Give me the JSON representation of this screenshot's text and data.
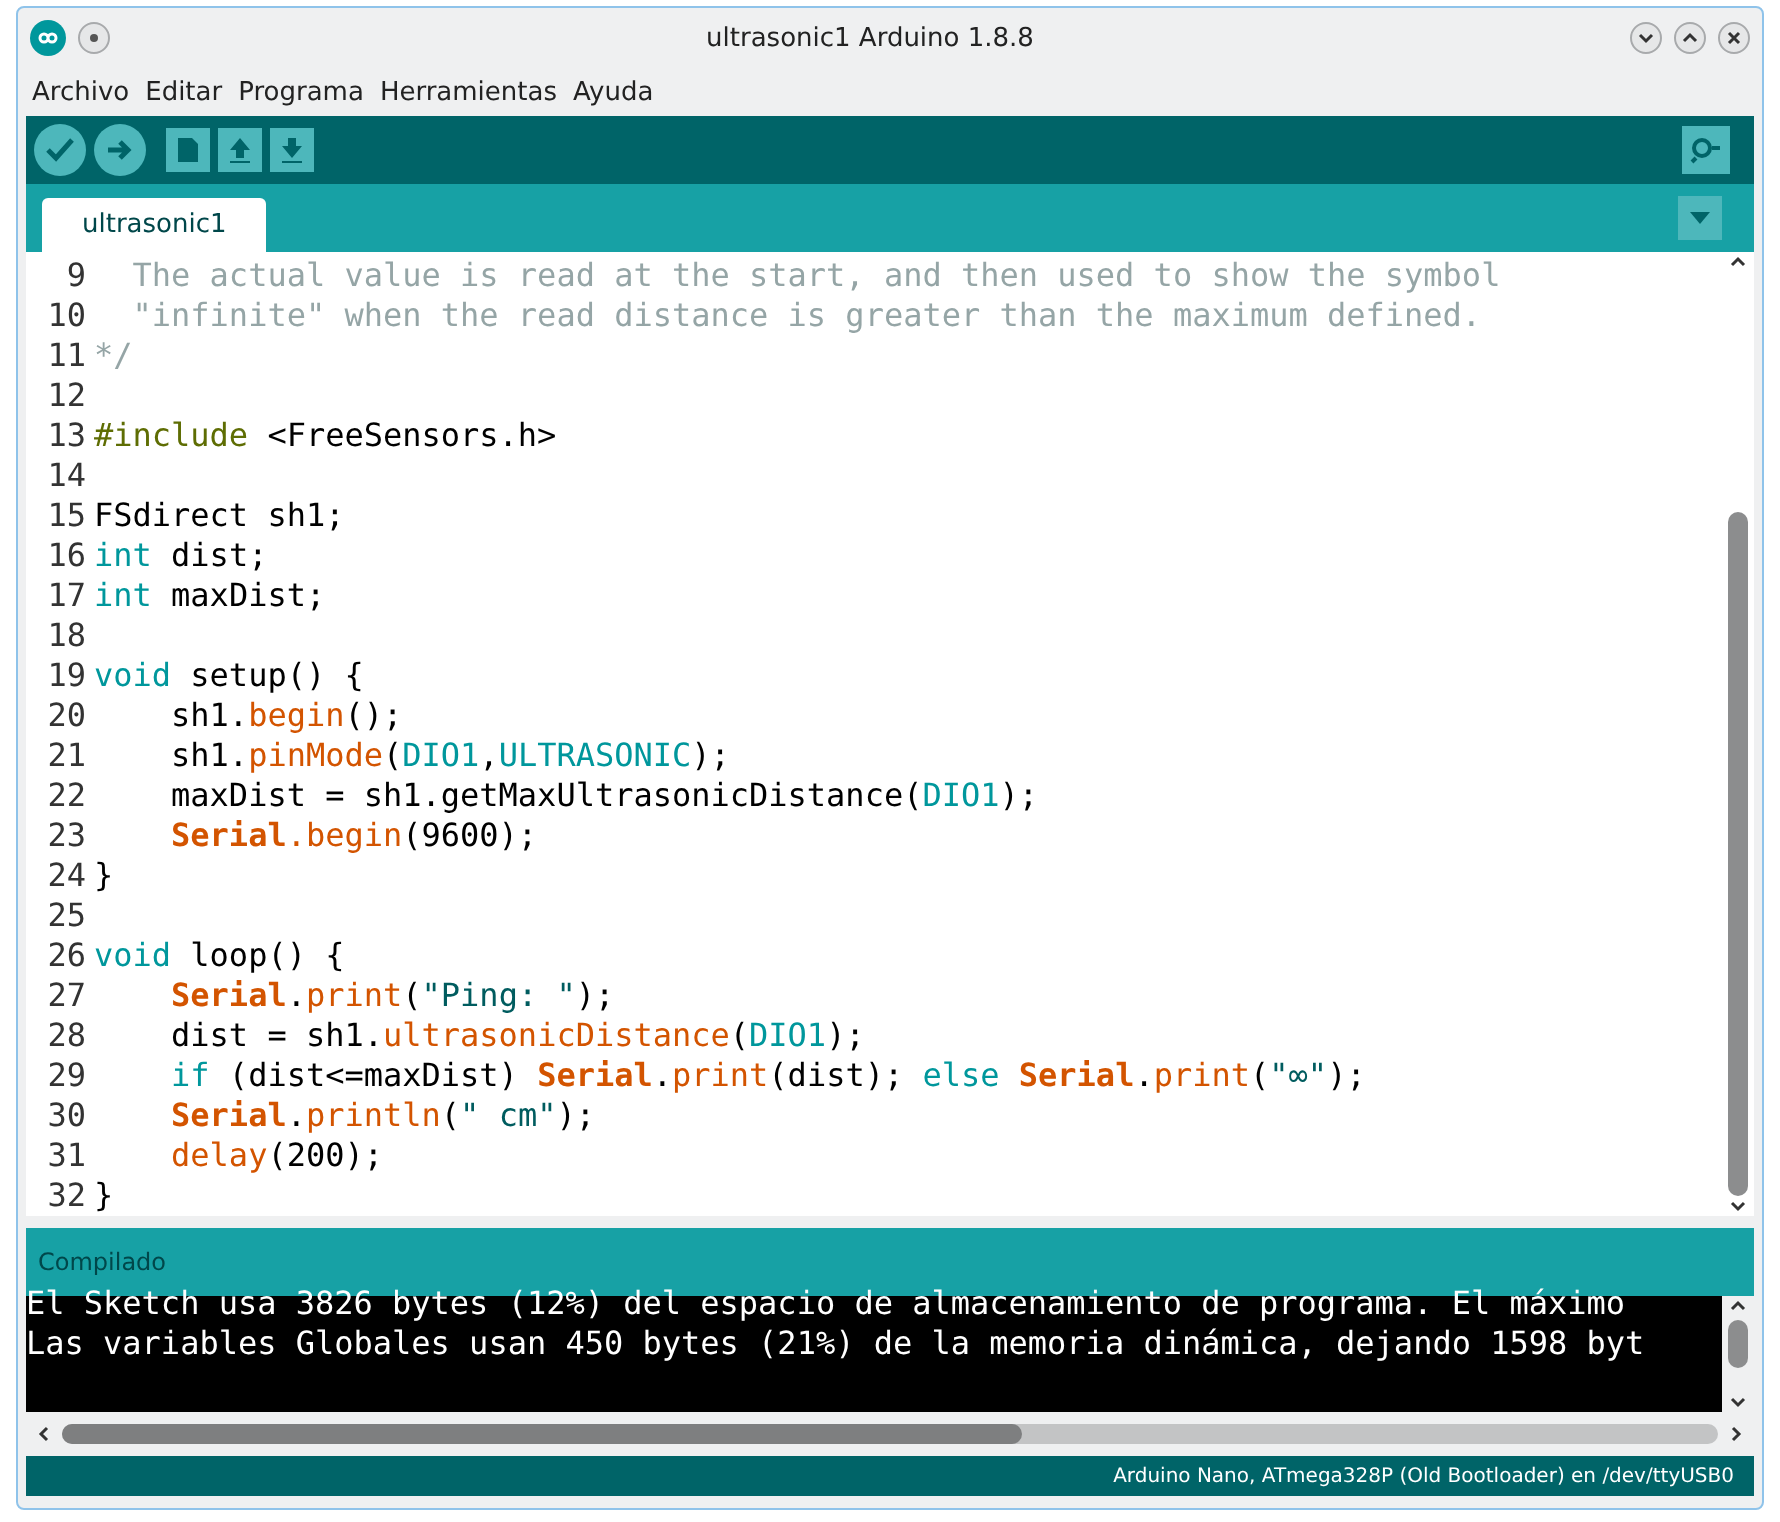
{
  "window": {
    "title": "ultrasonic1 Arduino 1.8.8"
  },
  "menu": [
    "Archivo",
    "Editar",
    "Programa",
    "Herramientas",
    "Ayuda"
  ],
  "tabs": [
    {
      "label": "ultrasonic1",
      "selected": true
    }
  ],
  "code": {
    "lines": [
      {
        "number": "9",
        "tokens": [
          {
            "kind": "comment",
            "text": "  The actual value is read at the start, and then used to show the symbol"
          }
        ]
      },
      {
        "number": "10",
        "tokens": [
          {
            "kind": "comment",
            "text": "  \"infinite\" when the read distance is greater than the maximum defined."
          }
        ]
      },
      {
        "number": "11",
        "tokens": [
          {
            "kind": "comment",
            "text": "*/"
          }
        ]
      },
      {
        "number": "12"
      },
      {
        "number": "13",
        "tokens": [
          {
            "kind": "include",
            "text": "#include"
          },
          {
            "kind": "plain",
            "text": " <FreeSensors.h>"
          }
        ]
      },
      {
        "number": "14"
      },
      {
        "number": "15",
        "tokens": [
          {
            "kind": "plain",
            "text": "FSdirect sh1;"
          }
        ]
      },
      {
        "number": "16",
        "tokens": [
          {
            "kind": "keyword",
            "text": "int"
          },
          {
            "kind": "plain",
            "text": " dist;"
          }
        ]
      },
      {
        "number": "17",
        "tokens": [
          {
            "kind": "keyword",
            "text": "int"
          },
          {
            "kind": "plain",
            "text": " maxDist;"
          }
        ]
      },
      {
        "number": "18"
      },
      {
        "number": "19",
        "tokens": [
          {
            "kind": "keyword",
            "text": "void"
          },
          {
            "kind": "plain",
            "text": " setup() {"
          }
        ]
      },
      {
        "number": "20",
        "tokens": [
          {
            "kind": "plain",
            "text": "    sh1."
          },
          {
            "kind": "function",
            "text": "begin"
          },
          {
            "kind": "plain",
            "text": "();"
          }
        ]
      },
      {
        "number": "21",
        "tokens": [
          {
            "kind": "plain",
            "text": "    sh1."
          },
          {
            "kind": "function",
            "text": "pinMode"
          },
          {
            "kind": "plain",
            "text": "("
          },
          {
            "kind": "constant",
            "text": "DIO1"
          },
          {
            "kind": "plain",
            "text": ","
          },
          {
            "kind": "constant",
            "text": "ULTRASONIC"
          },
          {
            "kind": "plain",
            "text": ");"
          }
        ]
      },
      {
        "number": "22",
        "tokens": [
          {
            "kind": "plain",
            "text": "    maxDist = sh1.getMaxUltrasonicDistance("
          },
          {
            "kind": "constant",
            "text": "DIO1"
          },
          {
            "kind": "plain",
            "text": ");"
          }
        ]
      },
      {
        "number": "23",
        "tokens": [
          {
            "kind": "class",
            "text": "    Serial"
          },
          {
            "kind": "function",
            "text": ".begin"
          },
          {
            "kind": "plain",
            "text": "(9600);"
          }
        ]
      },
      {
        "number": "24",
        "tokens": [
          {
            "kind": "plain",
            "text": "}"
          }
        ]
      },
      {
        "number": "25"
      },
      {
        "number": "26",
        "tokens": [
          {
            "kind": "keyword",
            "text": "void"
          },
          {
            "kind": "plain",
            "text": " loop() {"
          }
        ]
      },
      {
        "number": "27",
        "tokens": [
          {
            "kind": "class",
            "text": "    Serial"
          },
          {
            "kind": "plain",
            "text": "."
          },
          {
            "kind": "function",
            "text": "print"
          },
          {
            "kind": "plain",
            "text": "("
          },
          {
            "kind": "string",
            "text": "\"Ping: \""
          },
          {
            "kind": "plain",
            "text": ");"
          }
        ]
      },
      {
        "number": "28",
        "tokens": [
          {
            "kind": "plain",
            "text": "    dist = sh1."
          },
          {
            "kind": "function",
            "text": "ultrasonicDistance"
          },
          {
            "kind": "plain",
            "text": "("
          },
          {
            "kind": "constant",
            "text": "DIO1"
          },
          {
            "kind": "plain",
            "text": ");"
          }
        ]
      },
      {
        "number": "29",
        "tokens": [
          {
            "kind": "keyword",
            "text": "    if"
          },
          {
            "kind": "plain",
            "text": " (dist<=maxDist) "
          },
          {
            "kind": "class",
            "text": "Serial"
          },
          {
            "kind": "plain",
            "text": "."
          },
          {
            "kind": "function",
            "text": "print"
          },
          {
            "kind": "plain",
            "text": "(dist); "
          },
          {
            "kind": "keyword",
            "text": "else"
          },
          {
            "kind": "class",
            "text": " Serial"
          },
          {
            "kind": "plain",
            "text": "."
          },
          {
            "kind": "function",
            "text": "print"
          },
          {
            "kind": "plain",
            "text": "("
          },
          {
            "kind": "string",
            "text": "\"∞\""
          },
          {
            "kind": "plain",
            "text": ");"
          }
        ]
      },
      {
        "number": "30",
        "tokens": [
          {
            "kind": "class",
            "text": "    Serial"
          },
          {
            "kind": "plain",
            "text": "."
          },
          {
            "kind": "function",
            "text": "println"
          },
          {
            "kind": "plain",
            "text": "("
          },
          {
            "kind": "string",
            "text": "\" cm\""
          },
          {
            "kind": "plain",
            "text": ");"
          }
        ]
      },
      {
        "number": "31",
        "tokens": [
          {
            "kind": "function",
            "text": "    delay"
          },
          {
            "kind": "plain",
            "text": "(200);"
          }
        ]
      },
      {
        "number": "32",
        "tokens": [
          {
            "kind": "plain",
            "text": "}"
          }
        ]
      }
    ]
  },
  "console": {
    "status": "Compilado",
    "lines": [
      "El Sketch usa 3826 bytes (12%) del espacio de almacenamiento de programa. El máximo",
      "Las variables Globales usan 450 bytes (21%) de la memoria dinámica, dejando 1598 byt"
    ]
  },
  "status_bar": "Arduino Nano, ATmega328P (Old Bootloader) en /dev/ttyUSB0"
}
